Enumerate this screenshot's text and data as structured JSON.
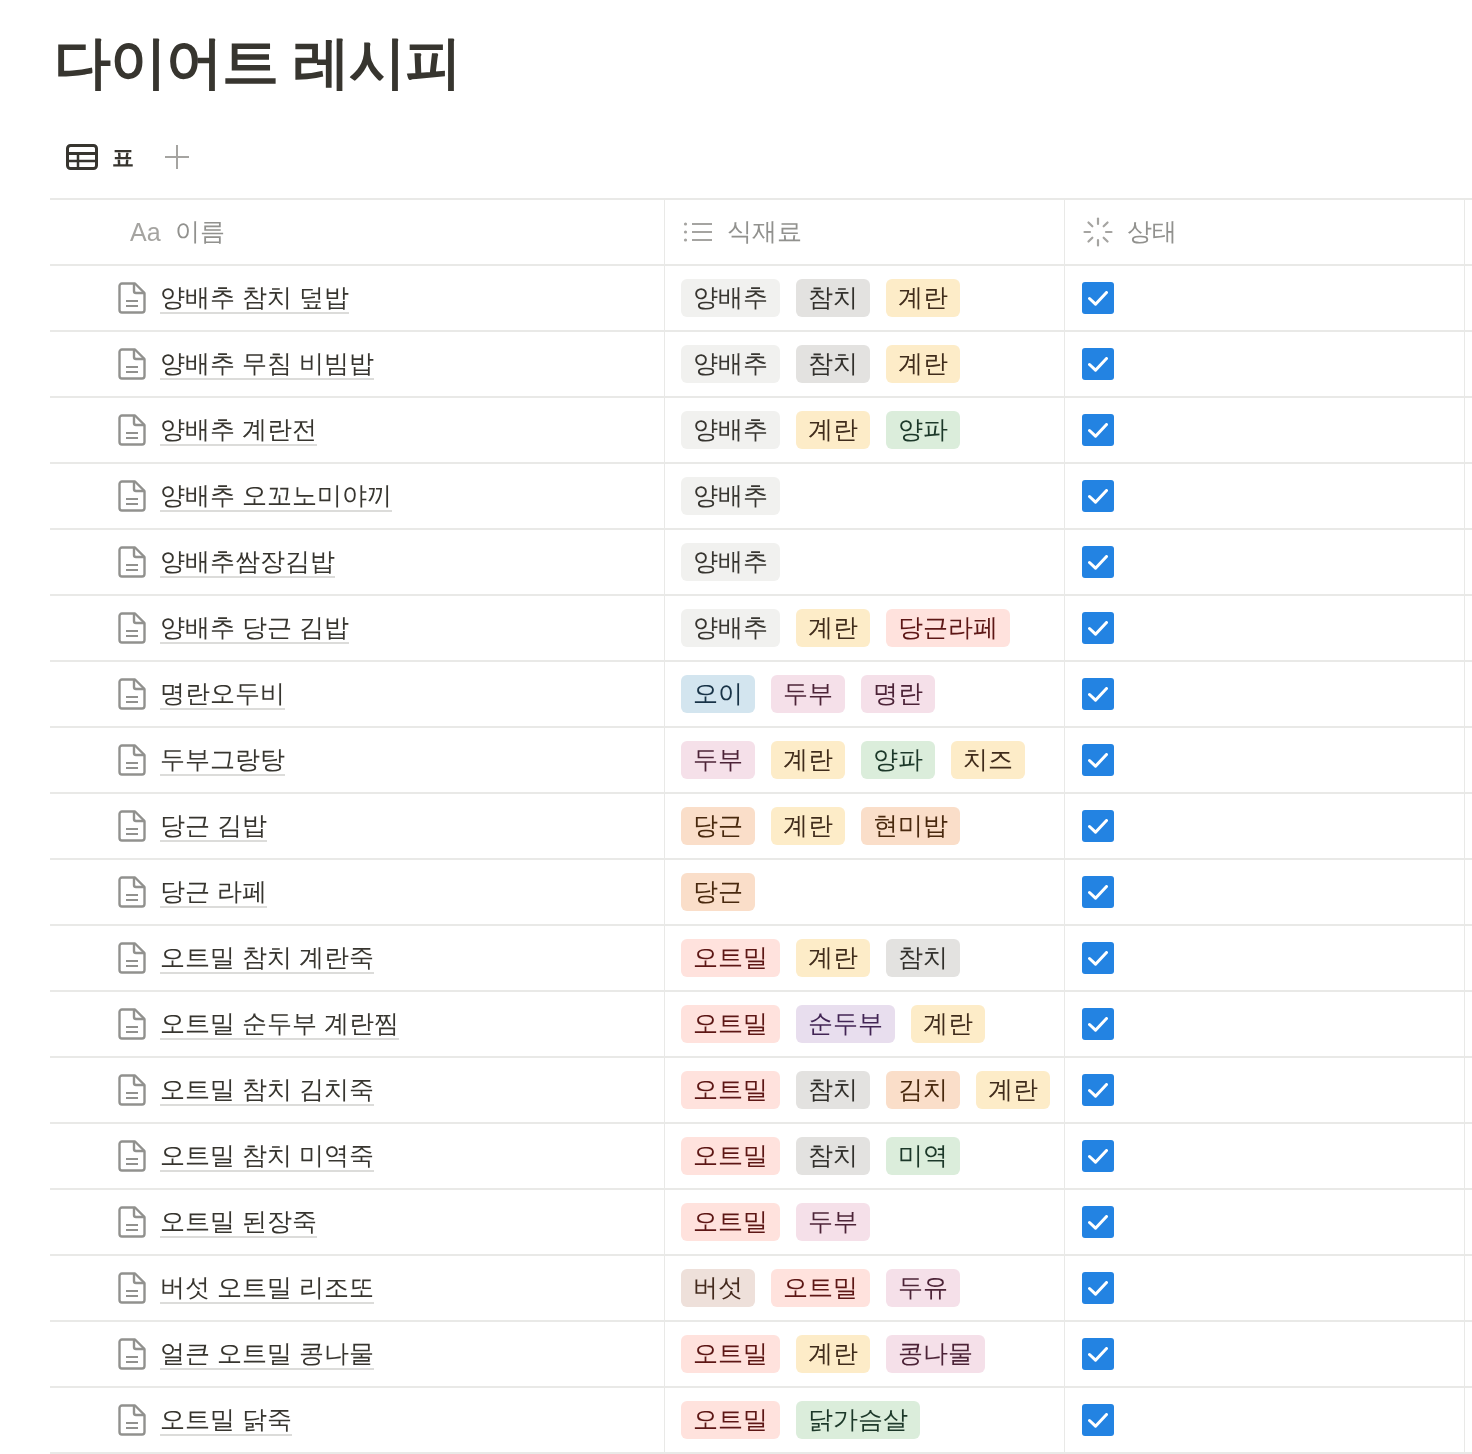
{
  "page": {
    "title": "다이어트 레시피"
  },
  "view_tabs": [
    {
      "label": "표",
      "kind": "table"
    }
  ],
  "table": {
    "columns": [
      {
        "kind": "title",
        "glyph": "Aa",
        "label": "이름"
      },
      {
        "kind": "multi_select",
        "label": "식재료"
      },
      {
        "kind": "status",
        "label": "상태"
      }
    ],
    "rows": [
      {
        "name": "양배추 참치 덮밥",
        "ingredients": [
          {
            "label": "양배추",
            "color": "#f1f1ef"
          },
          {
            "label": "참치",
            "color": "#e3e2e0"
          },
          {
            "label": "계란",
            "color": "#fdecc8"
          }
        ],
        "checked": true
      },
      {
        "name": "양배추 무침 비빔밥",
        "ingredients": [
          {
            "label": "양배추",
            "color": "#f1f1ef"
          },
          {
            "label": "참치",
            "color": "#e3e2e0"
          },
          {
            "label": "계란",
            "color": "#fdecc8"
          }
        ],
        "checked": true
      },
      {
        "name": "양배추 계란전",
        "ingredients": [
          {
            "label": "양배추",
            "color": "#f1f1ef"
          },
          {
            "label": "계란",
            "color": "#fdecc8"
          },
          {
            "label": "양파",
            "color": "#dbeddb"
          }
        ],
        "checked": true
      },
      {
        "name": "양배추 오꼬노미야끼",
        "ingredients": [
          {
            "label": "양배추",
            "color": "#f1f1ef"
          }
        ],
        "checked": true
      },
      {
        "name": "양배추쌈장김밥",
        "ingredients": [
          {
            "label": "양배추",
            "color": "#f1f1ef"
          }
        ],
        "checked": true
      },
      {
        "name": "양배추 당근 김밥",
        "ingredients": [
          {
            "label": "양배추",
            "color": "#f1f1ef"
          },
          {
            "label": "계란",
            "color": "#fdecc8"
          },
          {
            "label": "당근라페",
            "color": "#ffe2dd"
          }
        ],
        "checked": true
      },
      {
        "name": "명란오두비",
        "ingredients": [
          {
            "label": "오이",
            "color": "#d3e5ef"
          },
          {
            "label": "두부",
            "color": "#f5e0e9"
          },
          {
            "label": "명란",
            "color": "#f5e0e9"
          }
        ],
        "checked": true
      },
      {
        "name": "두부그랑탕",
        "ingredients": [
          {
            "label": "두부",
            "color": "#f5e0e9"
          },
          {
            "label": "계란",
            "color": "#fdecc8"
          },
          {
            "label": "양파",
            "color": "#dbeddb"
          },
          {
            "label": "치즈",
            "color": "#fdecc8"
          }
        ],
        "checked": true
      },
      {
        "name": "당근 김밥",
        "ingredients": [
          {
            "label": "당근",
            "color": "#fadec9"
          },
          {
            "label": "계란",
            "color": "#fdecc8"
          },
          {
            "label": "현미밥",
            "color": "#fadec9"
          }
        ],
        "checked": true
      },
      {
        "name": "당근 라페",
        "ingredients": [
          {
            "label": "당근",
            "color": "#fadec9"
          }
        ],
        "checked": true
      },
      {
        "name": "오트밀 참치 계란죽",
        "ingredients": [
          {
            "label": "오트밀",
            "color": "#ffe2dd"
          },
          {
            "label": "계란",
            "color": "#fdecc8"
          },
          {
            "label": "참치",
            "color": "#e3e2e0"
          }
        ],
        "checked": true
      },
      {
        "name": "오트밀 순두부 계란찜",
        "ingredients": [
          {
            "label": "오트밀",
            "color": "#ffe2dd"
          },
          {
            "label": "순두부",
            "color": "#e8deee"
          },
          {
            "label": "계란",
            "color": "#fdecc8"
          }
        ],
        "checked": true
      },
      {
        "name": "오트밀 참치 김치죽",
        "ingredients": [
          {
            "label": "오트밀",
            "color": "#ffe2dd"
          },
          {
            "label": "참치",
            "color": "#e3e2e0"
          },
          {
            "label": "김치",
            "color": "#fadec9"
          },
          {
            "label": "계란",
            "color": "#fdecc8"
          }
        ],
        "checked": true
      },
      {
        "name": "오트밀 참치 미역죽",
        "ingredients": [
          {
            "label": "오트밀",
            "color": "#ffe2dd"
          },
          {
            "label": "참치",
            "color": "#e3e2e0"
          },
          {
            "label": "미역",
            "color": "#dbeddb"
          }
        ],
        "checked": true
      },
      {
        "name": "오트밀 된장죽",
        "ingredients": [
          {
            "label": "오트밀",
            "color": "#ffe2dd"
          },
          {
            "label": "두부",
            "color": "#f5e0e9"
          }
        ],
        "checked": true
      },
      {
        "name": "버섯 오트밀 리조또",
        "ingredients": [
          {
            "label": "버섯",
            "color": "#eee0da"
          },
          {
            "label": "오트밀",
            "color": "#ffe2dd"
          },
          {
            "label": "두유",
            "color": "#f5e0e9"
          }
        ],
        "checked": true
      },
      {
        "name": "얼큰 오트밀 콩나물",
        "ingredients": [
          {
            "label": "오트밀",
            "color": "#ffe2dd"
          },
          {
            "label": "계란",
            "color": "#fdecc8"
          },
          {
            "label": "콩나물",
            "color": "#f5e0e9"
          }
        ],
        "checked": true
      },
      {
        "name": "오트밀 닭죽",
        "ingredients": [
          {
            "label": "오트밀",
            "color": "#ffe2dd"
          },
          {
            "label": "닭가슴살",
            "color": "#dbeddb"
          }
        ],
        "checked": true
      }
    ]
  }
}
